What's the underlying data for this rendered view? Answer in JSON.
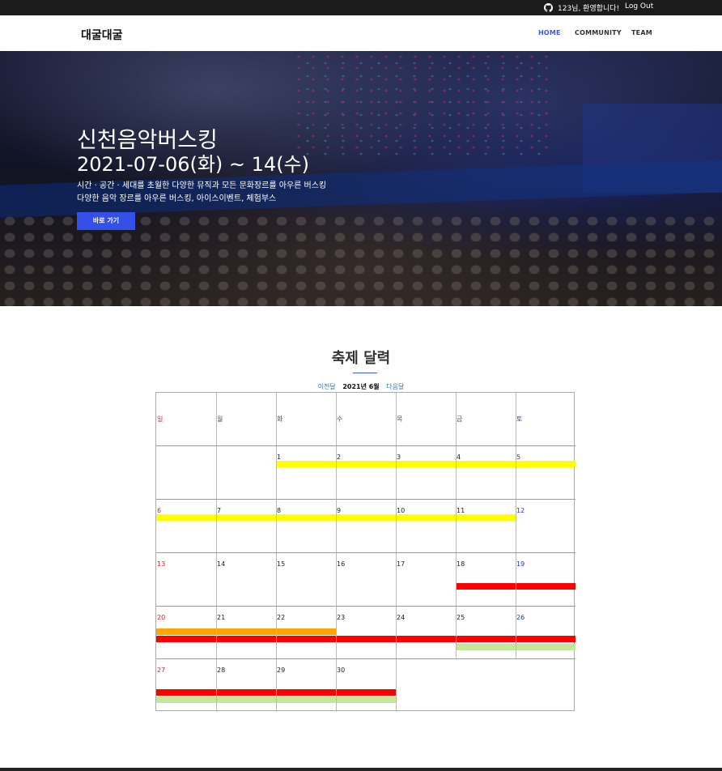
{
  "topbar": {
    "github_icon": "github-icon",
    "greeting": "123님, 환영합니다!",
    "logout": "Log Out"
  },
  "header": {
    "brand": "대굴대굴",
    "nav": [
      {
        "label": "HOME",
        "active": true
      },
      {
        "label": "COMMUNITY",
        "active": false
      },
      {
        "label": "TEAM",
        "active": false
      }
    ],
    "accent_color": "#3b5bdb"
  },
  "hero": {
    "title": "신천음악버스킹",
    "dates": "2021-07-06(화) ~ 14(수)",
    "desc1": "시간 · 공간 · 세대를 초월한 다양한 뮤직과 모든 문화장르를 아우른 버스킹",
    "desc2": "다양한 음악 장르를 아우른 버스킹, 아이스이벤트, 체험부스",
    "button": "바로 가기",
    "button_color": "#3550e8"
  },
  "calendar": {
    "section_title": "축제 달력",
    "prev": "이전달",
    "current": "2021년  6월",
    "next": "다음달",
    "weekdays": [
      "일",
      "월",
      "화",
      "수",
      "목",
      "금",
      "토"
    ],
    "weeks": [
      [
        "",
        "",
        "1",
        "2",
        "3",
        "4",
        "5"
      ],
      [
        "6",
        "7",
        "8",
        "9",
        "10",
        "11",
        "12"
      ],
      [
        "13",
        "14",
        "15",
        "16",
        "17",
        "18",
        "19"
      ],
      [
        "20",
        "21",
        "22",
        "23",
        "24",
        "25",
        "26"
      ],
      [
        "27",
        "28",
        "29",
        "30",
        "",
        "",
        ""
      ]
    ],
    "event_colors": {
      "yellow": "#ffff00",
      "red": "#ff0000",
      "orange": "#ffa500",
      "light_green": "#c4e89a"
    }
  }
}
